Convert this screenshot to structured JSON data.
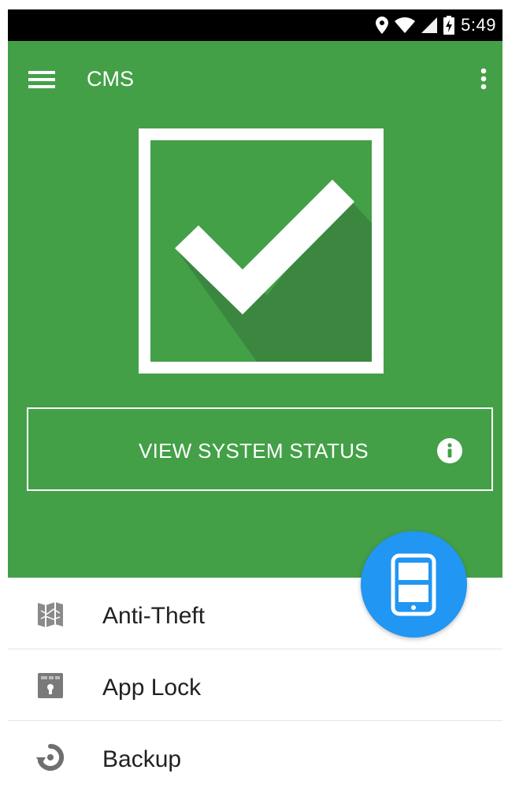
{
  "status_bar": {
    "time": "5:49",
    "icons": [
      "location-icon",
      "wifi-icon",
      "signal-icon",
      "battery-charging-icon"
    ]
  },
  "toolbar": {
    "title": "CMS",
    "menu_icon": "hamburger-menu-icon",
    "overflow_icon": "more-vertical-icon"
  },
  "hero": {
    "status_icon": "checkmark-icon",
    "status_button_label": "VIEW SYSTEM STATUS",
    "info_icon": "info-icon"
  },
  "fab": {
    "icon": "phone-icon"
  },
  "list": {
    "items": [
      {
        "label": "Anti-Theft",
        "icon": "map-icon"
      },
      {
        "label": "App Lock",
        "icon": "lock-icon"
      },
      {
        "label": "Backup",
        "icon": "backup-icon"
      }
    ]
  },
  "colors": {
    "primary_green": "#43a047",
    "dark_green_shadow": "#3b8740",
    "fab_blue": "#2196f3",
    "text_dark": "#212121"
  }
}
